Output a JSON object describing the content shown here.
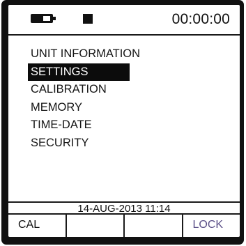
{
  "status": {
    "battery_icon": "battery-icon",
    "record_icon": "square-indicator-icon",
    "time": "00:00:00"
  },
  "menu": {
    "items": [
      {
        "label": "UNIT INFORMATION",
        "selected": false
      },
      {
        "label": "SETTINGS",
        "selected": true
      },
      {
        "label": "CALIBRATION",
        "selected": false
      },
      {
        "label": "MEMORY",
        "selected": false
      },
      {
        "label": "TIME-DATE",
        "selected": false
      },
      {
        "label": "SECURITY",
        "selected": false
      }
    ]
  },
  "date_bar": {
    "text": "14-AUG-2013   11:14"
  },
  "softkeys": [
    {
      "label": "CAL"
    },
    {
      "label": ""
    },
    {
      "label": ""
    },
    {
      "label": "LOCK",
      "color": "#5a4f87"
    }
  ],
  "colors": {
    "bezel": "#111111",
    "screen": "#ffffff",
    "selection": "#0c0c0c",
    "lock_text": "#5a4f87"
  }
}
